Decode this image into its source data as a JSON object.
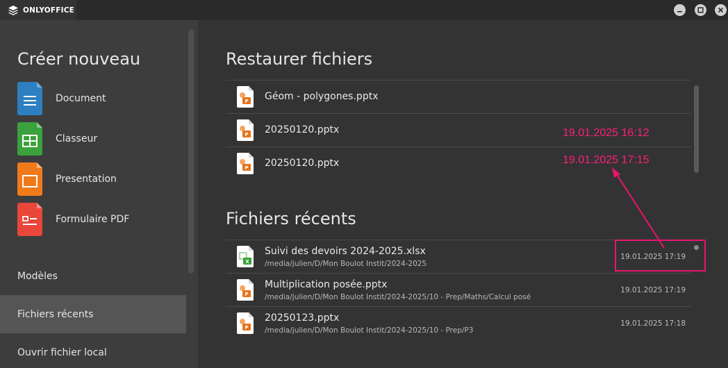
{
  "titlebar": {
    "brand": "ONLYOFFICE",
    "logo_icon": "onlyoffice-layers-icon",
    "minimize_icon": "minimize-icon",
    "maximize_icon": "maximize-icon",
    "close_icon": "close-icon"
  },
  "sidebar": {
    "create_title": "Créer nouveau",
    "create_items": [
      {
        "label": "Document",
        "icon": "document-icon",
        "color": "#2d7fc1"
      },
      {
        "label": "Classeur",
        "icon": "spreadsheet-icon",
        "color": "#3aa13c"
      },
      {
        "label": "Presentation",
        "icon": "presentation-icon",
        "color": "#f07a1a"
      },
      {
        "label": "Formulaire PDF",
        "icon": "pdf-form-icon",
        "color": "#e8473a"
      }
    ],
    "nav": [
      {
        "label": "Modèles",
        "active": false
      },
      {
        "label": "Fichiers récents",
        "active": true
      },
      {
        "label": "Ouvrir fichier local",
        "active": false
      }
    ]
  },
  "restore": {
    "title": "Restaurer fichiers",
    "files": [
      {
        "name": "Géom - polygones.pptx",
        "type": "pptx"
      },
      {
        "name": "20250120.pptx",
        "type": "pptx"
      },
      {
        "name": "20250120.pptx",
        "type": "pptx"
      }
    ]
  },
  "recent": {
    "title": "Fichiers récents",
    "files": [
      {
        "name": "Suivi des devoirs 2024-2025.xlsx",
        "path": "/media/julien/D/Mon Boulot Instit/2024-2025",
        "date": "19.01.2025 17:19",
        "type": "xlsx"
      },
      {
        "name": "Multiplication posée.pptx",
        "path": "/media/julien/D/Mon Boulot Instit/2024-2025/10 - Prep/Maths/Calcul posé",
        "date": "19.01.2025 17:19",
        "type": "pptx"
      },
      {
        "name": "20250123.pptx",
        "path": "/media/julien/D/Mon Boulot Instit/2024-2025/10 - Prep/P3",
        "date": "19.01.2025 17:18",
        "type": "pptx"
      }
    ]
  },
  "annotations": {
    "note1": "19.01.2025 16:12",
    "note2": "19.01.2025 17:15",
    "color": "#ff1f7a"
  }
}
